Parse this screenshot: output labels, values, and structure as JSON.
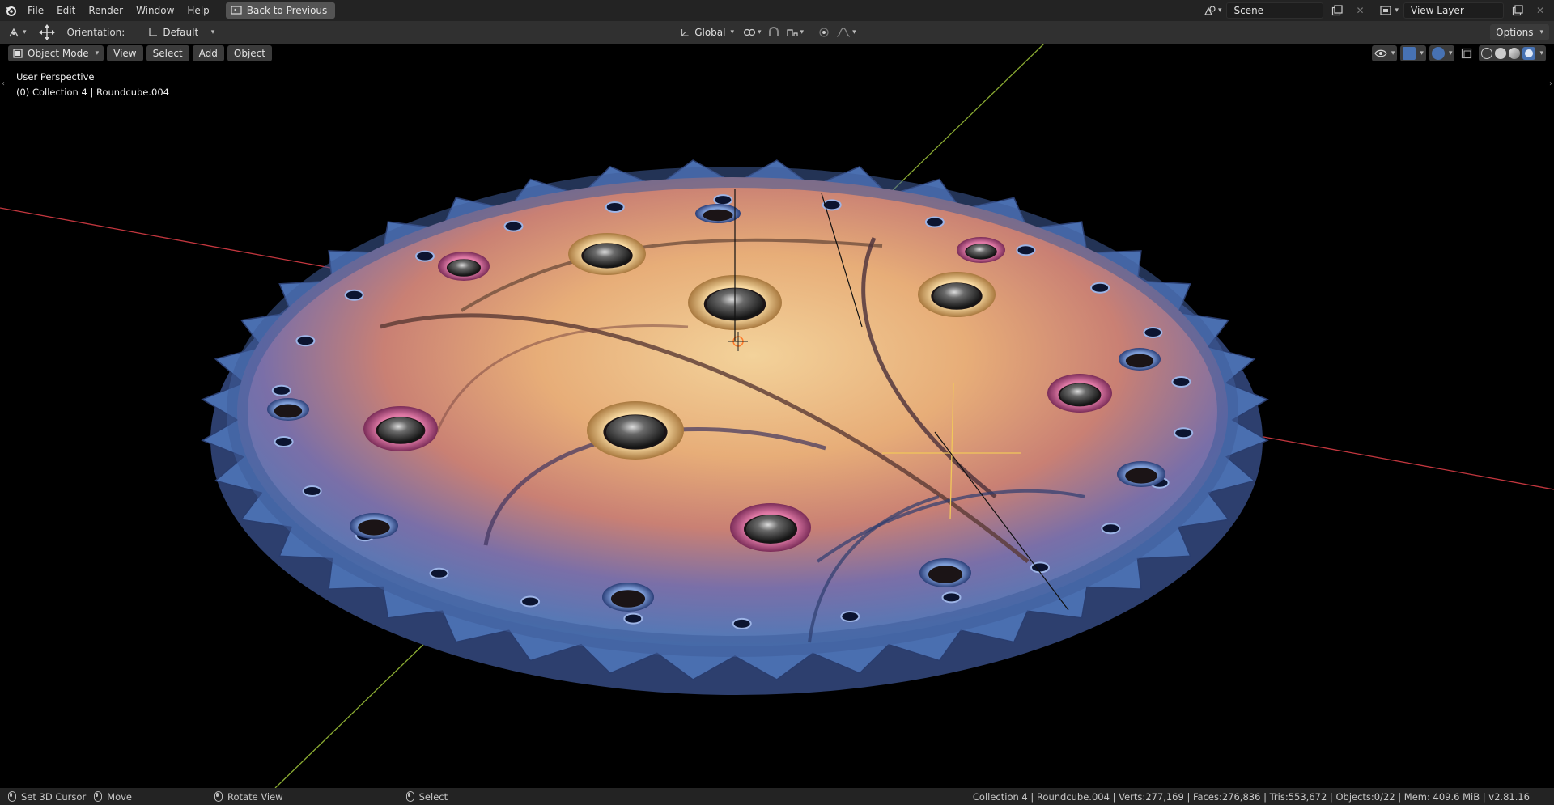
{
  "topbar": {
    "menus": [
      "File",
      "Edit",
      "Render",
      "Window",
      "Help"
    ],
    "back_label": "Back to Previous",
    "scene_label": "Scene",
    "view_layer_label": "View Layer"
  },
  "toolheader": {
    "orientation_label": "Orientation:",
    "orientation_value": "Default",
    "transform_space": "Global",
    "options_label": "Options"
  },
  "viewport": {
    "mode_label": "Object Mode",
    "menus": [
      "View",
      "Select",
      "Add",
      "Object"
    ],
    "perspective": "User Perspective",
    "collection_info": "(0) Collection 4 | Roundcube.004"
  },
  "statusbar": {
    "set_cursor": "Set 3D Cursor",
    "move": "Move",
    "rotate": "Rotate View",
    "select": "Select",
    "stats": "Collection 4 | Roundcube.004 | Verts:277,169 | Faces:276,836 | Tris:553,672 | Objects:0/22 | Mem: 409.6 MiB | v2.81.16"
  },
  "colors": {
    "background": "#000000",
    "x_axis": "#c2363e",
    "y_axis": "#8aab32",
    "gear_gold": "#e8b97a",
    "gear_blue": "#5878b8"
  }
}
